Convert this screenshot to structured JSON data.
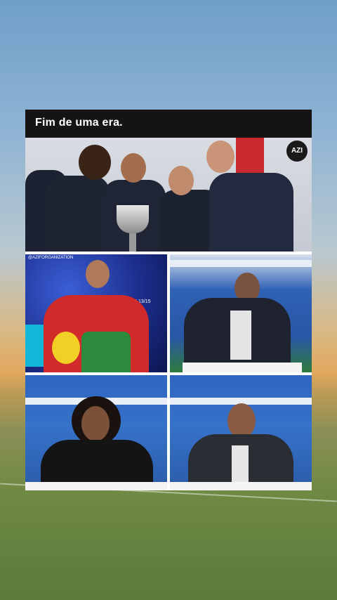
{
  "card": {
    "title": "Fim de uma era."
  },
  "top_photo": {
    "logo_text": "AZI"
  },
  "photo1": {
    "social_handle": "@AZIFORGANIZATION",
    "banner": "#CHAMP 13/15"
  },
  "colors": {
    "title_bar": "#141414",
    "card": "#ffffff",
    "stadium_blue": "#2f66c0",
    "suit": "#1f2330"
  }
}
